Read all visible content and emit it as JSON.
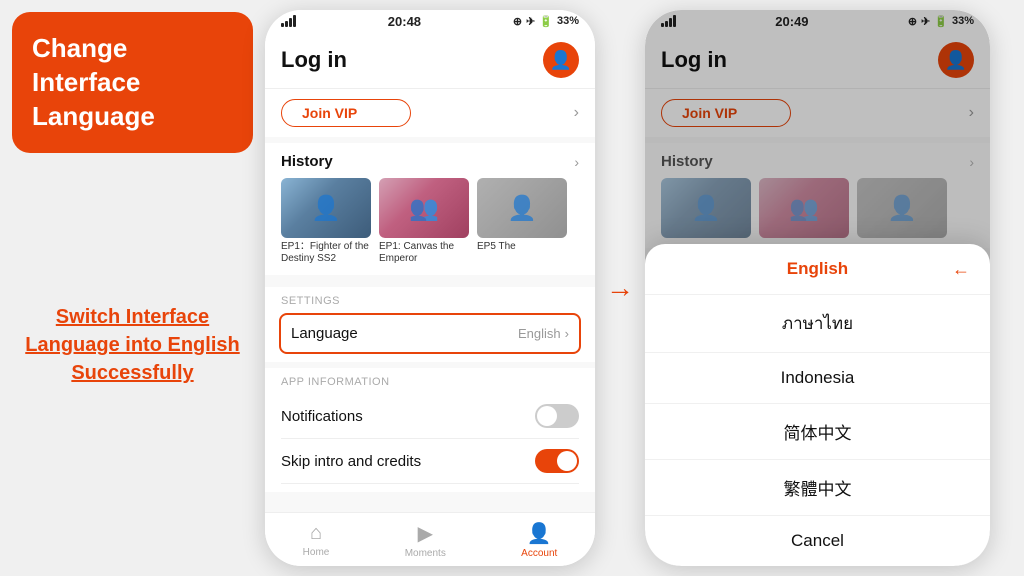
{
  "annotation": {
    "title": "Change Interface Language",
    "subtitle": "Switch Interface Language into English Successfully"
  },
  "phone1": {
    "status": {
      "time": "20:48",
      "battery": "33%"
    },
    "header": {
      "title": "Log in"
    },
    "vip": {
      "label": "Join VIP"
    },
    "history": {
      "title": "History",
      "items": [
        {
          "caption": "EP1：Fighter of the Destiny SS2"
        },
        {
          "caption": "EP1: Canvas the Emperor"
        },
        {
          "caption": "EP5 The"
        }
      ]
    },
    "settings": {
      "section_label": "SETTINGS",
      "language_label": "Language",
      "language_value": "English"
    },
    "appinfo": {
      "section_label": "APP INFORMATION",
      "notifications_label": "Notifications",
      "skip_label": "Skip intro and credits"
    },
    "nav": {
      "items": [
        {
          "label": "Home",
          "active": false
        },
        {
          "label": "Moments",
          "active": false
        },
        {
          "label": "Account",
          "active": true
        }
      ]
    }
  },
  "phone2": {
    "status": {
      "time": "20:49",
      "battery": "33%"
    },
    "header": {
      "title": "Log in"
    },
    "vip": {
      "label": "Join VIP"
    },
    "history": {
      "title": "History"
    },
    "language_picker": {
      "options": [
        {
          "label": "English",
          "selected": true
        },
        {
          "label": "ภาษาไทย",
          "selected": false
        },
        {
          "label": "Indonesia",
          "selected": false
        },
        {
          "label": "简体中文",
          "selected": false
        },
        {
          "label": "繁體中文",
          "selected": false
        },
        {
          "label": "Cancel",
          "selected": false,
          "cancel": true
        }
      ]
    }
  }
}
